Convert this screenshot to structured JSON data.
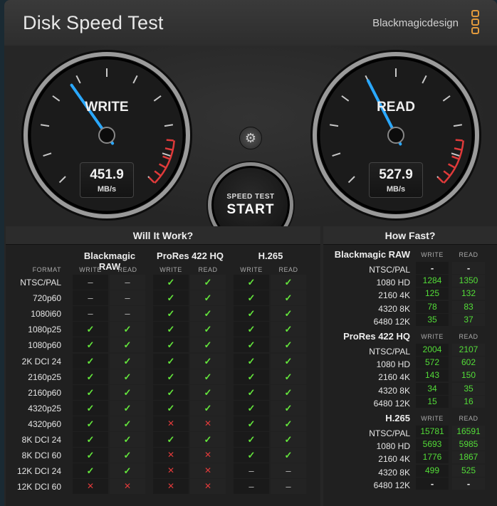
{
  "app": {
    "title": "Disk Speed Test",
    "brand": "Blackmagicdesign"
  },
  "write": {
    "label": "WRITE",
    "value": "451.9",
    "unit": "MB/s",
    "needle_fraction": 0.37
  },
  "read": {
    "label": "READ",
    "value": "527.9",
    "unit": "MB/s",
    "needle_fraction": 0.4
  },
  "start": {
    "sub_label": "SPEED TEST",
    "main_label": "START"
  },
  "will_it_work": {
    "heading": "Will It Work?",
    "format_header": "FORMAT",
    "codecs": [
      "Blackmagic RAW",
      "ProRes 422 HQ",
      "H.265"
    ],
    "sub_headers": [
      "WRITE",
      "READ"
    ],
    "rows": [
      {
        "format": "NTSC/PAL",
        "cells": [
          "na",
          "na",
          "ok",
          "ok",
          "ok",
          "ok"
        ]
      },
      {
        "format": "720p60",
        "cells": [
          "na",
          "na",
          "ok",
          "ok",
          "ok",
          "ok"
        ]
      },
      {
        "format": "1080i60",
        "cells": [
          "na",
          "na",
          "ok",
          "ok",
          "ok",
          "ok"
        ]
      },
      {
        "format": "1080p25",
        "cells": [
          "ok",
          "ok",
          "ok",
          "ok",
          "ok",
          "ok"
        ]
      },
      {
        "format": "1080p60",
        "cells": [
          "ok",
          "ok",
          "ok",
          "ok",
          "ok",
          "ok"
        ]
      },
      {
        "format": "2K DCI 24",
        "cells": [
          "ok",
          "ok",
          "ok",
          "ok",
          "ok",
          "ok"
        ]
      },
      {
        "format": "2160p25",
        "cells": [
          "ok",
          "ok",
          "ok",
          "ok",
          "ok",
          "ok"
        ]
      },
      {
        "format": "2160p60",
        "cells": [
          "ok",
          "ok",
          "ok",
          "ok",
          "ok",
          "ok"
        ]
      },
      {
        "format": "4320p25",
        "cells": [
          "ok",
          "ok",
          "ok",
          "ok",
          "ok",
          "ok"
        ]
      },
      {
        "format": "4320p60",
        "cells": [
          "ok",
          "ok",
          "no",
          "no",
          "ok",
          "ok"
        ]
      },
      {
        "format": "8K DCI 24",
        "cells": [
          "ok",
          "ok",
          "ok",
          "ok",
          "ok",
          "ok"
        ]
      },
      {
        "format": "8K DCI 60",
        "cells": [
          "ok",
          "ok",
          "no",
          "no",
          "ok",
          "ok"
        ]
      },
      {
        "format": "12K DCI 24",
        "cells": [
          "ok",
          "ok",
          "no",
          "no",
          "na",
          "na"
        ]
      },
      {
        "format": "12K DCI 60",
        "cells": [
          "no",
          "no",
          "no",
          "no",
          "na",
          "na"
        ]
      }
    ]
  },
  "how_fast": {
    "heading": "How Fast?",
    "write_header": "WRITE",
    "read_header": "READ",
    "groups": [
      {
        "codec": "Blackmagic RAW",
        "rows": [
          {
            "format": "NTSC/PAL",
            "write": "-",
            "read": "-"
          },
          {
            "format": "1080 HD",
            "write": "1284",
            "read": "1350"
          },
          {
            "format": "2160 4K",
            "write": "125",
            "read": "132"
          },
          {
            "format": "4320 8K",
            "write": "78",
            "read": "83"
          },
          {
            "format": "6480 12K",
            "write": "35",
            "read": "37"
          }
        ]
      },
      {
        "codec": "ProRes 422 HQ",
        "rows": [
          {
            "format": "NTSC/PAL",
            "write": "2004",
            "read": "2107"
          },
          {
            "format": "1080 HD",
            "write": "572",
            "read": "602"
          },
          {
            "format": "2160 4K",
            "write": "143",
            "read": "150"
          },
          {
            "format": "4320 8K",
            "write": "34",
            "read": "35"
          },
          {
            "format": "6480 12K",
            "write": "15",
            "read": "16"
          }
        ]
      },
      {
        "codec": "H.265",
        "rows": [
          {
            "format": "NTSC/PAL",
            "write": "15781",
            "read": "16591"
          },
          {
            "format": "1080 HD",
            "write": "5693",
            "read": "5985"
          },
          {
            "format": "2160 4K",
            "write": "1776",
            "read": "1867"
          },
          {
            "format": "4320 8K",
            "write": "499",
            "read": "525"
          },
          {
            "format": "6480 12K",
            "write": "-",
            "read": "-"
          }
        ]
      }
    ]
  },
  "colors": {
    "accent_blue": "#2aa8ff",
    "ok_green": "#64e63c",
    "fail_red": "#e03a3a",
    "redzone": "#e03a3a"
  }
}
